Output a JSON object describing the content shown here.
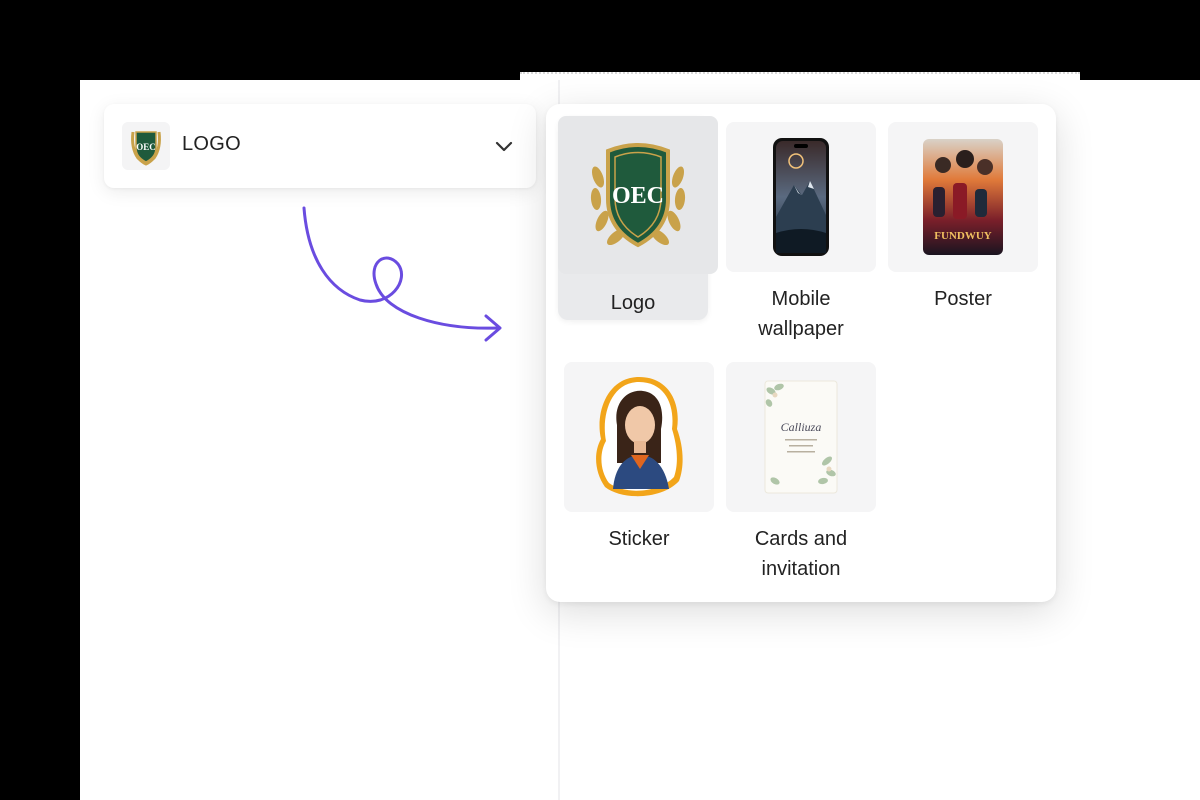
{
  "select": {
    "label": "LOGO",
    "thumb_icon": "oec-crest-logo-icon",
    "chevron_icon": "chevron-down-icon"
  },
  "dropdown": {
    "options": [
      {
        "label": "Logo",
        "icon": "oec-crest-logo-icon",
        "selected": true
      },
      {
        "label": "Mobile wallpaper",
        "icon": "phone-mountain-wallpaper-icon",
        "selected": false
      },
      {
        "label": "Poster",
        "icon": "movie-poster-icon",
        "selected": false
      },
      {
        "label": "Sticker",
        "icon": "woman-portrait-sticker-icon",
        "selected": false
      },
      {
        "label": "Cards and invitation",
        "icon": "floral-invitation-card-icon",
        "selected": false
      }
    ]
  },
  "thumbs": {
    "crest_letters": "OEC",
    "poster_title": "FUNDWUY",
    "card_script": "Calliuza"
  },
  "colors": {
    "accent_arrow": "#6a4ce0",
    "crest_green": "#1f5a3c",
    "crest_gold": "#c9a24a"
  }
}
